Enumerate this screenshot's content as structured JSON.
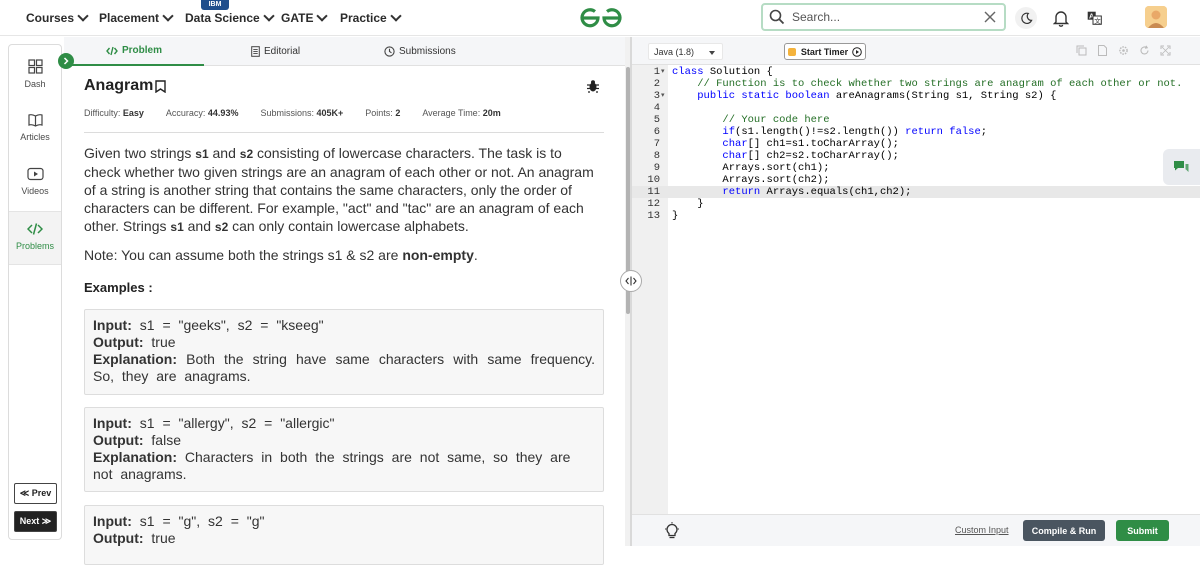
{
  "nav": {
    "items": [
      {
        "label": "Courses"
      },
      {
        "label": "Placement"
      },
      {
        "label": "Data Science"
      },
      {
        "label": "GATE"
      },
      {
        "label": "Practice"
      }
    ],
    "ibm_badge": "IBM",
    "search_placeholder": "Search..."
  },
  "rail": {
    "items": [
      {
        "label": "Dash"
      },
      {
        "label": "Articles"
      },
      {
        "label": "Videos"
      },
      {
        "label": "Problems"
      }
    ],
    "prev": "≪ Prev",
    "next": "Next ≫"
  },
  "problem": {
    "tabs": [
      {
        "label": "Problem"
      },
      {
        "label": "Editorial"
      },
      {
        "label": "Submissions"
      }
    ],
    "title": "Anagram",
    "meta": {
      "difficulty_label": "Difficulty:",
      "difficulty": "Easy",
      "accuracy_label": "Accuracy:",
      "accuracy": "44.93%",
      "submissions_label": "Submissions:",
      "submissions": "405K+",
      "points_label": "Points:",
      "points": "2",
      "avg_time_label": "Average Time:",
      "avg_time": "20m"
    },
    "description": {
      "p1": "Given two strings ",
      "s1": "s1",
      "p2": " and ",
      "s2": "s2",
      "p3": " consisting of lowercase characters. The task is to check whether two given strings are an anagram of each other or not. An anagram of a string is another string that contains the same characters, only the order of characters can be different. For example, \"act\" and \"tac\" are an anagram of each other. Strings ",
      "p4": " and ",
      "p5": " can only contain lowercase alphabets."
    },
    "note": {
      "text": "Note: You can assume both the strings s1 & s2 are ",
      "bold": "non-empty",
      "end": "."
    },
    "examples_heading": "Examples :",
    "examples": [
      {
        "input_label": "Input:",
        "input": "s1 = \"geeks\", s2 = \"kseeg\"",
        "output_label": "Output:",
        "output": "true",
        "explanation_label": "Explanation:",
        "explanation": "Both the string have same characters with same frequency. So, they are anagrams."
      },
      {
        "input_label": "Input:",
        "input": "s1 = \"allergy\", s2 = \"allergic\"",
        "output_label": "Output:",
        "output": "false",
        "explanation_label": "Explanation:",
        "explanation": "Characters in both the strings are not same, so they are not anagrams."
      },
      {
        "input_label": "Input:",
        "input": "s1 = \"g\", s2 = \"g\"",
        "output_label": "Output:",
        "output": "true"
      }
    ]
  },
  "editor": {
    "language": "Java (1.8)",
    "timer_label": "Start Timer",
    "line_numbers": [
      "1",
      "2",
      "3",
      "4",
      "5",
      "6",
      "7",
      "8",
      "9",
      "10",
      "11",
      "12",
      "13"
    ],
    "code_lines": [
      [
        {
          "t": "kw",
          "v": "class"
        },
        {
          "t": "pl",
          "v": " Solution {"
        }
      ],
      [
        {
          "t": "pl",
          "v": "    "
        },
        {
          "t": "cm",
          "v": "// Function is to check whether two strings are anagram of each other or not."
        }
      ],
      [
        {
          "t": "pl",
          "v": "    "
        },
        {
          "t": "kw",
          "v": "public static boolean"
        },
        {
          "t": "pl",
          "v": " areAnagrams(String s1, String s2) {"
        }
      ],
      [
        {
          "t": "pl",
          "v": ""
        }
      ],
      [
        {
          "t": "pl",
          "v": "        "
        },
        {
          "t": "cm",
          "v": "// Your code here"
        }
      ],
      [
        {
          "t": "pl",
          "v": "        "
        },
        {
          "t": "kw",
          "v": "if"
        },
        {
          "t": "pl",
          "v": "(s1.length()!=s2.length()) "
        },
        {
          "t": "kw",
          "v": "return false"
        },
        {
          "t": "pl",
          "v": ";"
        }
      ],
      [
        {
          "t": "pl",
          "v": "        "
        },
        {
          "t": "kw",
          "v": "char"
        },
        {
          "t": "pl",
          "v": "[] ch1=s1.toCharArray();"
        }
      ],
      [
        {
          "t": "pl",
          "v": "        "
        },
        {
          "t": "kw",
          "v": "char"
        },
        {
          "t": "pl",
          "v": "[] ch2=s2.toCharArray();"
        }
      ],
      [
        {
          "t": "pl",
          "v": "        Arrays.sort(ch1);"
        }
      ],
      [
        {
          "t": "pl",
          "v": "        Arrays.sort(ch2);"
        }
      ],
      [
        {
          "t": "pl",
          "v": "        "
        },
        {
          "t": "kw",
          "v": "return"
        },
        {
          "t": "pl",
          "v": " Arrays.equals(ch1,ch2);"
        }
      ],
      [
        {
          "t": "pl",
          "v": "    }"
        }
      ],
      [
        {
          "t": "pl",
          "v": "}"
        }
      ]
    ],
    "custom_input": "Custom Input",
    "compile_run": "Compile & Run",
    "submit": "Submit"
  },
  "colors": {
    "brand_green": "#2f8d46",
    "keyword_blue": "#0000ff",
    "comment_green": "#236e25",
    "run_button": "#4a5560"
  },
  "icons": [
    "search-icon",
    "clear-icon",
    "moon-icon",
    "bell-icon",
    "translate-icon",
    "bug-icon",
    "bookmark-icon",
    "bulb-icon",
    "chat-icon"
  ]
}
